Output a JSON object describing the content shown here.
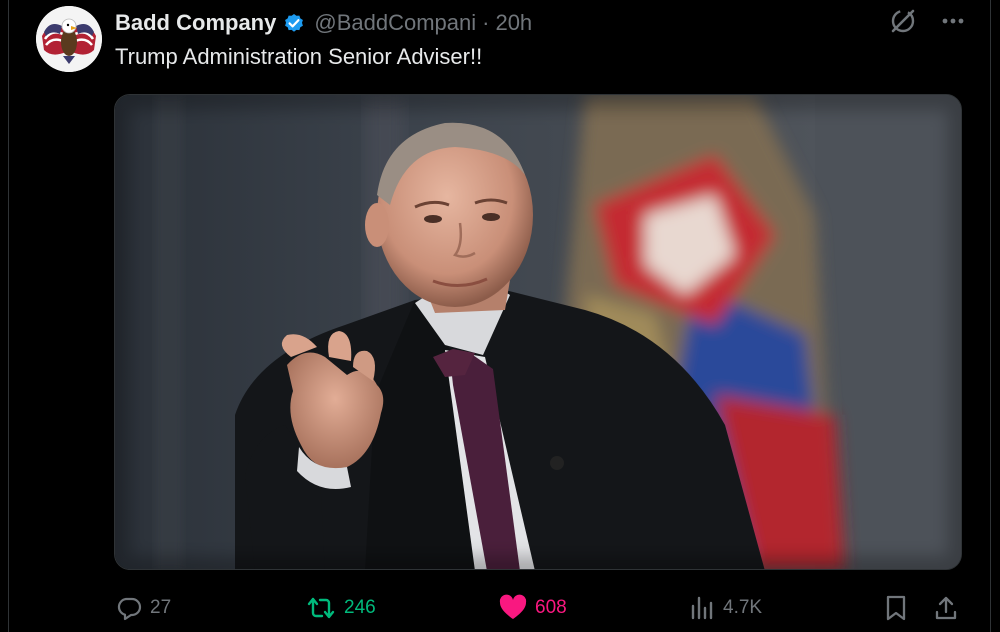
{
  "tweet": {
    "display_name": "Badd Company",
    "handle": "@BaddCompani",
    "separator": "·",
    "time": "20h",
    "text": "Trump Administration Senior Adviser!!"
  },
  "icons": {
    "verified": "verified-badge-icon",
    "grok": "grok-icon",
    "more": "more-icon"
  },
  "actions": {
    "replies": "27",
    "retweets": "246",
    "likes": "608",
    "views": "4.7K",
    "liked": true,
    "retweeted": true
  },
  "colors": {
    "background": "#000000",
    "text": "#e7e9ea",
    "muted": "#71767b",
    "verified": "#1d9bf0",
    "retweet": "#00ba7c",
    "like": "#f91880",
    "border": "#2f3336"
  }
}
